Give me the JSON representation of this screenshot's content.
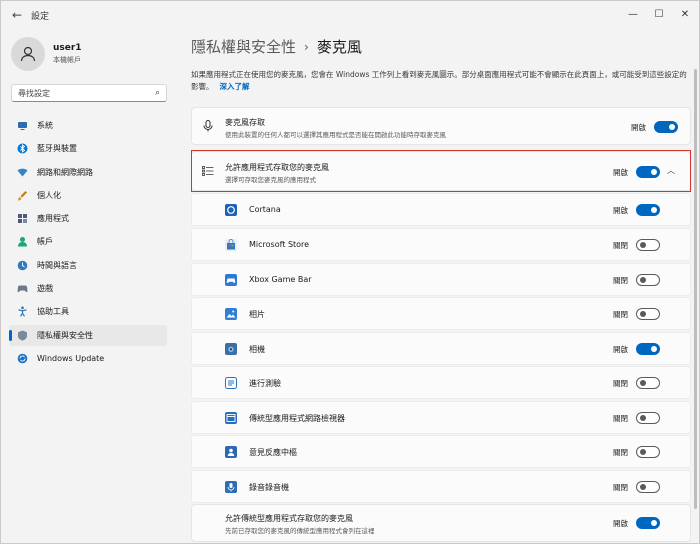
{
  "window": {
    "title": "設定",
    "back": "←",
    "minimize": "—",
    "maximize": "☐",
    "close": "✕"
  },
  "user": {
    "name": "user1",
    "account": "本機帳戶"
  },
  "search": {
    "placeholder": "尋找設定"
  },
  "sidebar": {
    "items": [
      {
        "label": "系統",
        "icon": "monitor-icon",
        "color": "#2b6cb0"
      },
      {
        "label": "藍牙與裝置",
        "icon": "bluetooth-icon",
        "color": "#0078d4"
      },
      {
        "label": "網路和網際網路",
        "icon": "wifi-icon",
        "color": "#2f86c8"
      },
      {
        "label": "個人化",
        "icon": "brush-icon",
        "color": "#c27c0e"
      },
      {
        "label": "應用程式",
        "icon": "apps-icon",
        "color": "#4a5a78"
      },
      {
        "label": "帳戶",
        "icon": "person-icon",
        "color": "#1fa37a"
      },
      {
        "label": "時間與語言",
        "icon": "globe-clock-icon",
        "color": "#2e7bbf"
      },
      {
        "label": "遊戲",
        "icon": "gamepad-icon",
        "color": "#6b7a8a"
      },
      {
        "label": "協助工具",
        "icon": "accessibility-icon",
        "color": "#1f6fb5"
      },
      {
        "label": "隱私權與安全性",
        "icon": "shield-icon",
        "color": "#7a8a9a",
        "active": true
      },
      {
        "label": "Windows Update",
        "icon": "update-icon",
        "color": "#1a73c7"
      }
    ]
  },
  "breadcrumb": {
    "parent": "隱私權與安全性",
    "separator": "›",
    "current": "麥克風"
  },
  "description": {
    "text": "如果應用程式正在使用您的麥克風，您會在 Windows 工作列上看到麥克風圖示。部分桌面應用程式可能不會顯示在此頁面上，或可能受到這些設定的影響。",
    "link": "深入了解"
  },
  "mic_access": {
    "title": "麥克風存取",
    "subtitle": "使用此裝置的任何人都可以選擇其應用程式是否能在開啟此功能時存取麥克風",
    "state": "開啟",
    "on": true
  },
  "app_access": {
    "title": "允許應用程式存取您的麥克風",
    "subtitle": "選擇可存取您麥克風的應用程式",
    "state": "開啟",
    "on": true
  },
  "apps": [
    {
      "name": "Cortana",
      "state": "開啟",
      "on": true,
      "icon": "cortana-icon",
      "color": "#1a63b8"
    },
    {
      "name": "Microsoft Store",
      "state": "關閉",
      "on": false,
      "icon": "store-icon",
      "color": "#2b78d0"
    },
    {
      "name": "Xbox Game Bar",
      "state": "關閉",
      "on": false,
      "icon": "xbox-icon",
      "color": "#2c7ad6"
    },
    {
      "name": "相片",
      "state": "關閉",
      "on": false,
      "icon": "photos-icon",
      "color": "#2f7fd4"
    },
    {
      "name": "相機",
      "state": "開啟",
      "on": true,
      "icon": "camera-icon",
      "color": "#3b6fa8"
    },
    {
      "name": "進行測驗",
      "state": "關閉",
      "on": false,
      "icon": "test-icon",
      "color": "#2471c4"
    },
    {
      "name": "傳統型應用程式網路檢視器",
      "state": "關閉",
      "on": false,
      "icon": "webview-icon",
      "color": "#2a6fbf"
    },
    {
      "name": "意見反應中樞",
      "state": "關閉",
      "on": false,
      "icon": "feedback-icon",
      "color": "#2d67b5"
    },
    {
      "name": "錄音錄音機",
      "state": "關閉",
      "on": false,
      "icon": "recorder-icon",
      "color": "#2a6fb6"
    }
  ],
  "desktop_access": {
    "title": "允許傳統型應用程式存取您的麥克風",
    "subtitle": "先前已存取您的麥克風的傳統型應用程式會列在這裡",
    "state": "開啟",
    "on": true
  }
}
